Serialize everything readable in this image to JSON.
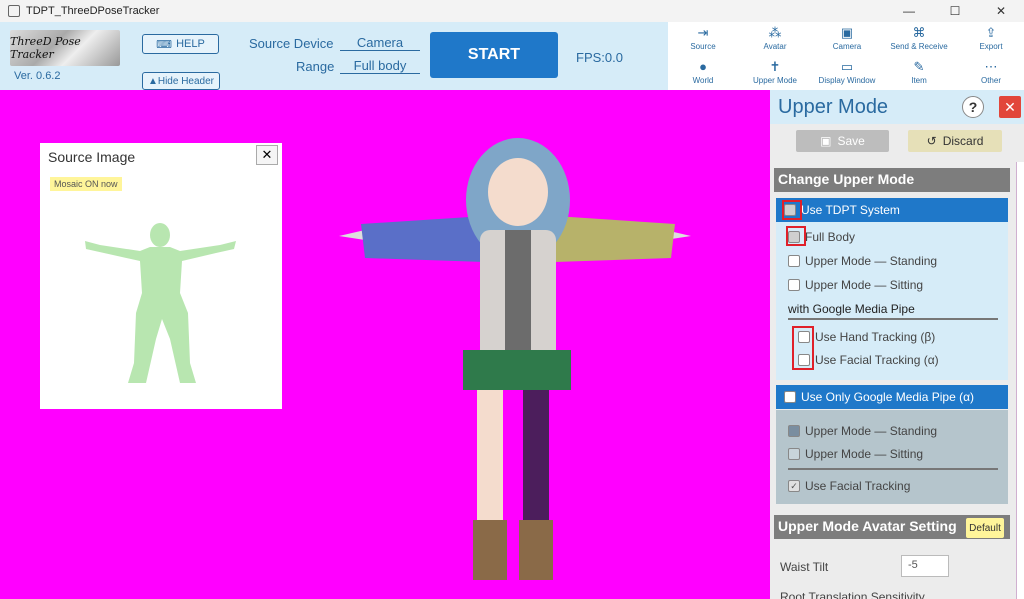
{
  "window": {
    "title": "TDPT_ThreeDPoseTracker",
    "controls": [
      "—",
      "☐",
      "✕"
    ]
  },
  "header": {
    "logo_text": "ThreeD Pose Tracker",
    "version": "Ver. 0.6.2",
    "help_label": "HELP",
    "hide_header_label": "▲Hide Header",
    "source_device_label": "Source Device",
    "source_device_value": "Camera",
    "range_label": "Range",
    "range_value": "Full body",
    "start_label": "START",
    "fps": "FPS:0.0"
  },
  "toolbar": {
    "row1": [
      {
        "label": "Source",
        "icon": "⇥"
      },
      {
        "label": "Avatar",
        "icon": "⁂"
      },
      {
        "label": "Camera",
        "icon": "▣"
      },
      {
        "label": "Send & Receive",
        "icon": "⌘"
      },
      {
        "label": "Export",
        "icon": "⇪"
      }
    ],
    "row2": [
      {
        "label": "World",
        "icon": "●"
      },
      {
        "label": "Upper Mode",
        "icon": "✝"
      },
      {
        "label": "Display Window",
        "icon": "▭"
      },
      {
        "label": "Item",
        "icon": "✎"
      },
      {
        "label": "Other",
        "icon": "⋯"
      }
    ]
  },
  "source_image": {
    "title": "Source Image",
    "close": "✕",
    "badge": "Mosaic ON now"
  },
  "panel": {
    "title": "Upper Mode",
    "help": "?",
    "close": "✕",
    "save": "Save",
    "discard": "Discard",
    "section_change": "Change Upper Mode",
    "use_tdpt": "Use TDPT System",
    "tdpt_options": [
      "Full Body",
      "Upper Mode — Standing",
      "Upper Mode — Sitting"
    ],
    "mediapipe_head": "with Google Media Pipe",
    "mediapipe_options": [
      "Use Hand Tracking (β)",
      "Use Facial Tracking (α)"
    ],
    "use_only_mediapipe": "Use Only Google Media Pipe (α)",
    "only_options": [
      "Upper Mode — Standing",
      "Upper Mode — Sitting"
    ],
    "facial_tracking": "Use Facial Tracking",
    "section_avatar": "Upper Mode Avatar Setting",
    "default": "Default",
    "waist_tilt_label": "Waist Tilt",
    "waist_tilt_value": "-5",
    "root_translation_label": "Root Translation Sensitivity"
  },
  "colors": {
    "stage": "#ff00ff",
    "accent": "#1f78c9",
    "header_bg": "#d6ecf8",
    "highlight": "#e0202a"
  }
}
